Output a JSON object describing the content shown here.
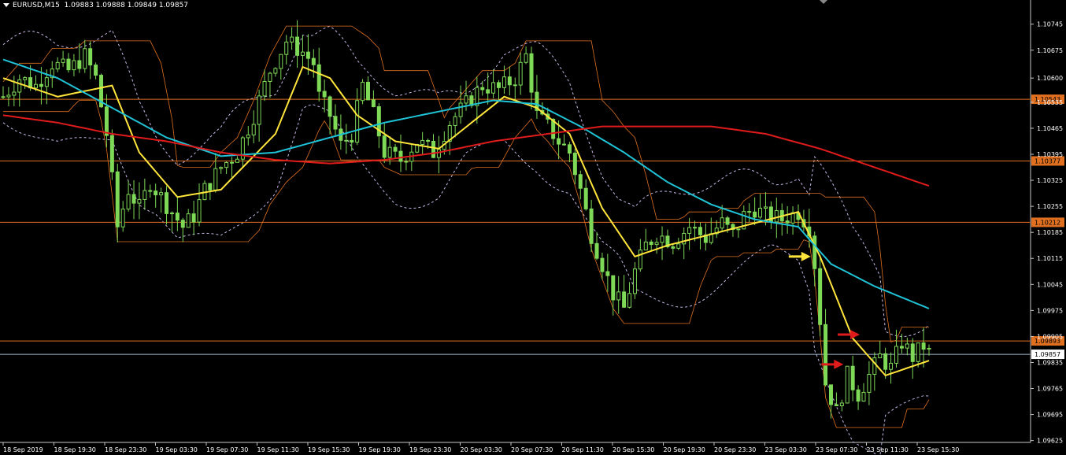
{
  "header": {
    "symbol": "EURUSD,M15",
    "ohlc": "1.09883 1.09888 1.09849 1.09857"
  },
  "colors": {
    "background": "#000000",
    "candle": "#7ed957",
    "ema_fast": "#ffe53b",
    "ema_mid": "#1fc3d6",
    "ema_slow": "#e01b1b",
    "bands": "#c9b6e8",
    "levels": "#e0701f",
    "bid_line": "#9fb6c8",
    "axis": "#c8c8c8"
  },
  "chart_data": {
    "type": "candlestick",
    "symbol": "EURUSD",
    "timeframe": "M15",
    "ylim": [
      1.0962,
      1.1081
    ],
    "y_ticks": [
      "1.10745",
      "1.10675",
      "1.10600",
      "1.10535",
      "1.10465",
      "1.10395",
      "1.10325",
      "1.10255",
      "1.10185",
      "1.10115",
      "1.10045",
      "1.09975",
      "1.09905",
      "1.09835",
      "1.09765",
      "1.09695",
      "1.09625"
    ],
    "x_ticks": [
      "18 Sep 2019",
      "18 Sep 19:30",
      "18 Sep 23:30",
      "19 Sep 03:30",
      "19 Sep 07:30",
      "19 Sep 11:30",
      "19 Sep 15:30",
      "19 Sep 19:30",
      "19 Sep 23:30",
      "20 Sep 03:30",
      "20 Sep 07:30",
      "20 Sep 11:30",
      "20 Sep 15:30",
      "20 Sep 19:30",
      "20 Sep 23:30",
      "23 Sep 03:30",
      "23 Sep 07:30",
      "23 Sep 11:30",
      "23 Sep 15:30"
    ],
    "horizontal_levels": [
      {
        "price": 1.10543,
        "label": "1.10543"
      },
      {
        "price": 1.10377,
        "label": "1.10377"
      },
      {
        "price": 1.10212,
        "label": "1.10212"
      },
      {
        "price": 1.09893,
        "label": "1.09893"
      }
    ],
    "current_price": {
      "price": 1.09857,
      "label": "1.09857"
    },
    "price_path": [
      [
        0,
        1.1055
      ],
      [
        3,
        1.106
      ],
      [
        6,
        1.1058
      ],
      [
        9,
        1.1064
      ],
      [
        12,
        1.1062
      ],
      [
        15,
        1.1066
      ],
      [
        17,
        1.106
      ],
      [
        19,
        1.1045
      ],
      [
        21,
        1.102
      ],
      [
        23,
        1.103
      ],
      [
        25,
        1.1025
      ],
      [
        27,
        1.1032
      ],
      [
        29,
        1.1028
      ],
      [
        31,
        1.1024
      ],
      [
        33,
        1.102
      ],
      [
        35,
        1.1023
      ],
      [
        37,
        1.103
      ],
      [
        40,
        1.1036
      ],
      [
        43,
        1.104
      ],
      [
        46,
        1.105
      ],
      [
        49,
        1.1062
      ],
      [
        52,
        1.107
      ],
      [
        55,
        1.1067
      ],
      [
        57,
        1.1064
      ],
      [
        58,
        1.1055
      ],
      [
        60,
        1.105
      ],
      [
        62,
        1.1042
      ],
      [
        64,
        1.1045
      ],
      [
        66,
        1.1058
      ],
      [
        68,
        1.105
      ],
      [
        70,
        1.104
      ],
      [
        73,
        1.1038
      ],
      [
        76,
        1.1043
      ],
      [
        79,
        1.104
      ],
      [
        82,
        1.1048
      ],
      [
        85,
        1.1053
      ],
      [
        88,
        1.1058
      ],
      [
        91,
        1.1057
      ],
      [
        94,
        1.106
      ],
      [
        96,
        1.1066
      ],
      [
        98,
        1.105
      ],
      [
        100,
        1.1047
      ],
      [
        102,
        1.1043
      ],
      [
        104,
        1.104
      ],
      [
        106,
        1.103
      ],
      [
        108,
        1.1018
      ],
      [
        110,
        1.101
      ],
      [
        112,
        1.1002
      ],
      [
        114,
        1.0998
      ],
      [
        116,
        1.1008
      ],
      [
        118,
        1.1015
      ],
      [
        120,
        1.1018
      ],
      [
        123,
        1.1016
      ],
      [
        126,
        1.102
      ],
      [
        129,
        1.1017
      ],
      [
        132,
        1.1021
      ],
      [
        134,
        1.1018
      ],
      [
        136,
        1.1023
      ],
      [
        138,
        1.1025
      ],
      [
        140,
        1.1023
      ],
      [
        143,
        1.1022
      ],
      [
        146,
        1.1024
      ],
      [
        148,
        1.102
      ],
      [
        149,
        1.101
      ],
      [
        150,
        1.0995
      ],
      [
        151,
        1.0978
      ],
      [
        153,
        1.097
      ],
      [
        155,
        1.098
      ],
      [
        157,
        1.0975
      ],
      [
        159,
        1.098
      ],
      [
        161,
        1.0985
      ],
      [
        163,
        1.0982
      ],
      [
        165,
        1.0989
      ],
      [
        167,
        1.0985
      ],
      [
        169,
        1.0988
      ],
      [
        170,
        1.0986
      ]
    ],
    "indicators": [
      {
        "name": "EMA fast",
        "color": "#ffe53b",
        "values": [
          [
            0,
            1.106
          ],
          [
            10,
            1.1055
          ],
          [
            20,
            1.1058
          ],
          [
            25,
            1.104
          ],
          [
            32,
            1.1028
          ],
          [
            40,
            1.103
          ],
          [
            50,
            1.1045
          ],
          [
            55,
            1.1063
          ],
          [
            60,
            1.106
          ],
          [
            65,
            1.105
          ],
          [
            72,
            1.1043
          ],
          [
            80,
            1.1041
          ],
          [
            86,
            1.1048
          ],
          [
            92,
            1.1055
          ],
          [
            98,
            1.1052
          ],
          [
            104,
            1.1045
          ],
          [
            110,
            1.1025
          ],
          [
            116,
            1.1012
          ],
          [
            122,
            1.1015
          ],
          [
            130,
            1.1018
          ],
          [
            138,
            1.1021
          ],
          [
            146,
            1.1024
          ],
          [
            150,
            1.1012
          ],
          [
            156,
            1.099
          ],
          [
            162,
            1.098
          ],
          [
            166,
            1.0982
          ],
          [
            170,
            1.0984
          ]
        ]
      },
      {
        "name": "EMA mid",
        "color": "#1fc3d6",
        "values": [
          [
            0,
            1.1065
          ],
          [
            10,
            1.106
          ],
          [
            20,
            1.1052
          ],
          [
            30,
            1.1044
          ],
          [
            40,
            1.1039
          ],
          [
            50,
            1.104
          ],
          [
            60,
            1.1044
          ],
          [
            70,
            1.1048
          ],
          [
            80,
            1.1051
          ],
          [
            90,
            1.1054
          ],
          [
            98,
            1.1053
          ],
          [
            106,
            1.1047
          ],
          [
            114,
            1.104
          ],
          [
            122,
            1.1032
          ],
          [
            130,
            1.1026
          ],
          [
            138,
            1.1022
          ],
          [
            146,
            1.102
          ],
          [
            152,
            1.101
          ],
          [
            160,
            1.1004
          ],
          [
            170,
            1.0998
          ]
        ]
      },
      {
        "name": "EMA slow",
        "color": "#e01b1b",
        "values": [
          [
            0,
            1.105
          ],
          [
            10,
            1.1048
          ],
          [
            20,
            1.1045
          ],
          [
            30,
            1.1043
          ],
          [
            40,
            1.104
          ],
          [
            50,
            1.1038
          ],
          [
            60,
            1.1037
          ],
          [
            70,
            1.1038
          ],
          [
            80,
            1.104
          ],
          [
            90,
            1.1043
          ],
          [
            100,
            1.1045
          ],
          [
            110,
            1.1047
          ],
          [
            120,
            1.1047
          ],
          [
            130,
            1.1047
          ],
          [
            140,
            1.1045
          ],
          [
            150,
            1.1041
          ],
          [
            160,
            1.1036
          ],
          [
            170,
            1.1031
          ]
        ]
      }
    ],
    "annotations": [
      {
        "type": "arrow",
        "color": "#ffe53b",
        "direction": "right",
        "at": [
          148,
          1.1012
        ]
      },
      {
        "type": "arrow",
        "color": "#e01b1b",
        "direction": "right",
        "at": [
          157,
          1.0991
        ]
      },
      {
        "type": "arrow",
        "color": "#e01b1b",
        "direction": "right",
        "at": [
          154,
          1.0983
        ]
      }
    ]
  }
}
